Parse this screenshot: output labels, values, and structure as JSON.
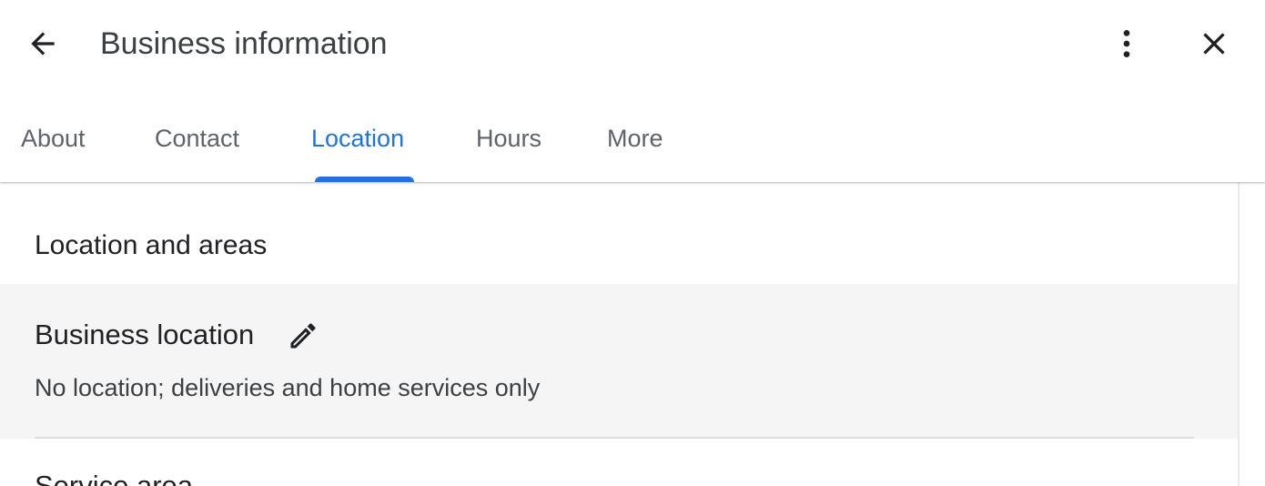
{
  "header": {
    "title": "Business information",
    "back_icon": "arrow-back-icon",
    "more_icon": "more-vert-icon",
    "close_icon": "close-icon"
  },
  "tabs": [
    {
      "label": "About",
      "active": false
    },
    {
      "label": "Contact",
      "active": false
    },
    {
      "label": "Location",
      "active": true
    },
    {
      "label": "Hours",
      "active": false
    },
    {
      "label": "More",
      "active": false
    }
  ],
  "colors": {
    "accent": "#1a73e8",
    "row_highlight": "#f5f5f5",
    "text_primary": "#202124",
    "text_secondary": "#5f6368"
  },
  "section": {
    "title": "Location and areas",
    "business_location": {
      "label": "Business location",
      "edit_icon": "pencil-edit-icon",
      "value": "No location; deliveries and home services only"
    },
    "service_area": {
      "label": "Service area"
    }
  }
}
